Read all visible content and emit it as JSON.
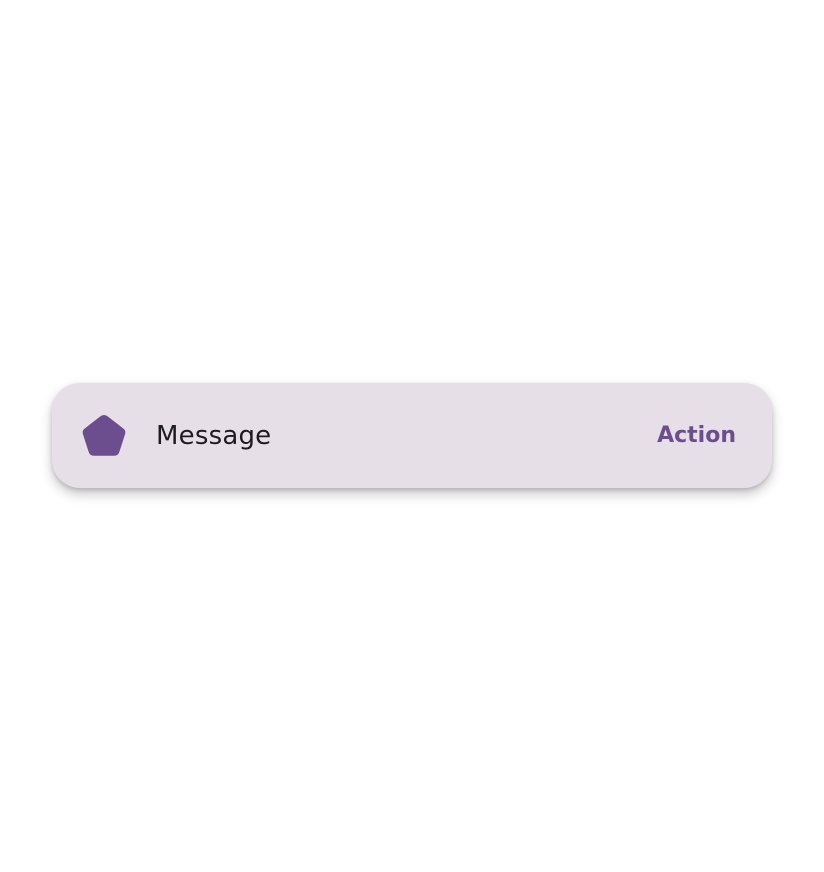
{
  "snackbar": {
    "icon": "pentagon-icon",
    "message": "Message",
    "action_label": "Action"
  },
  "colors": {
    "surface": "#e7dfe7",
    "accent": "#6c4d8d",
    "text": "#1d1b20",
    "background": "#ffffff"
  }
}
